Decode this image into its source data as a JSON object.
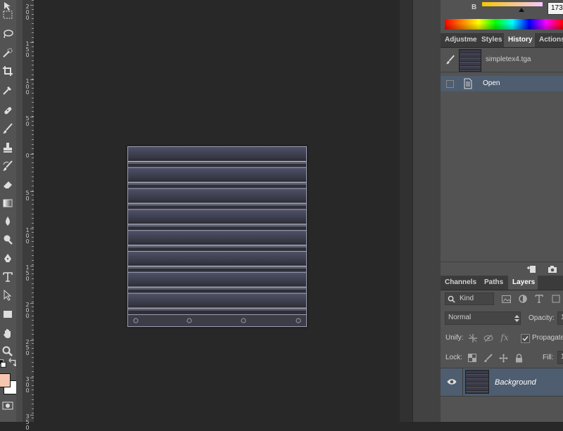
{
  "ruler": {
    "labels": [
      "200",
      "150",
      "100",
      "50",
      "0",
      "50",
      "100",
      "150",
      "200",
      "250",
      "300",
      "350"
    ]
  },
  "color_panel": {
    "slider_label": "B",
    "value": "173"
  },
  "history_panel": {
    "tabs": [
      "Adjustme",
      "Styles",
      "History",
      "Actions"
    ],
    "active_tab": "History",
    "snapshot_name": "simpletex4.tga",
    "items": [
      {
        "label": "Open",
        "selected": true
      }
    ]
  },
  "layers_panel": {
    "tabs": [
      "Channels",
      "Paths",
      "Layers"
    ],
    "active_tab": "Layers",
    "filter_kind": "Kind",
    "blend_mode": "Normal",
    "opacity_label": "Opacity:",
    "opacity_value": "1",
    "unify_label": "Unify:",
    "propagate_label": "Propagate",
    "lock_label": "Lock:",
    "fill_label": "Fill:",
    "fill_value": "1",
    "layers": [
      {
        "name": "Background",
        "visible": true
      }
    ]
  },
  "colors": {
    "foreground": "#f6c7ae",
    "background": "#ffffff",
    "selection": "#4e5d70"
  }
}
